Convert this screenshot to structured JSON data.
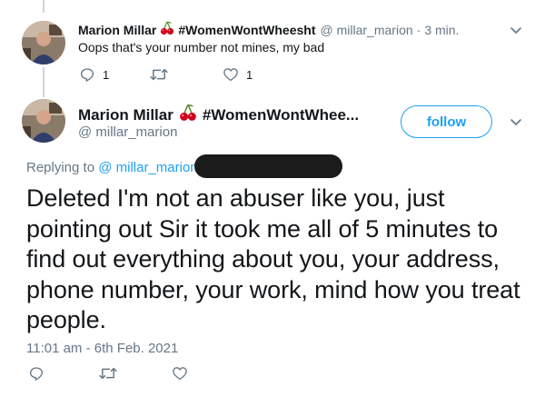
{
  "reply_tweet": {
    "display_name": "Marion Millar",
    "hashtag": "#WomenWontWheesht",
    "handle": "@ millar_marion",
    "separator": "·",
    "time": "3 min.",
    "text": "Oops that's your number not mines, my bad",
    "reply_count": "1",
    "like_count": "1"
  },
  "main_tweet": {
    "display_name": "Marion Millar",
    "hashtag": "#WomenWontWhee...",
    "handle": "@ millar_marion",
    "follow_label": "follow",
    "replying_prefix": "Replying to",
    "replying_handle": "@ millar_marion",
    "replying_extra": "@",
    "text": "Deleted I'm not an abuser like you, just pointing out Sir it took me all of 5 minutes to find out everything about you, your address, phone number, your work, mind how you treat people.",
    "timestamp": "11:01 am - 6th Feb. 2021"
  },
  "icons": [
    "reply-icon",
    "retweet-icon",
    "like-icon",
    "chevron-down-icon",
    "cherry-icon"
  ],
  "colors": {
    "accent": "#1da1f2",
    "muted": "#657786",
    "text": "#14171a",
    "thread_line": "#ccd6dd"
  }
}
